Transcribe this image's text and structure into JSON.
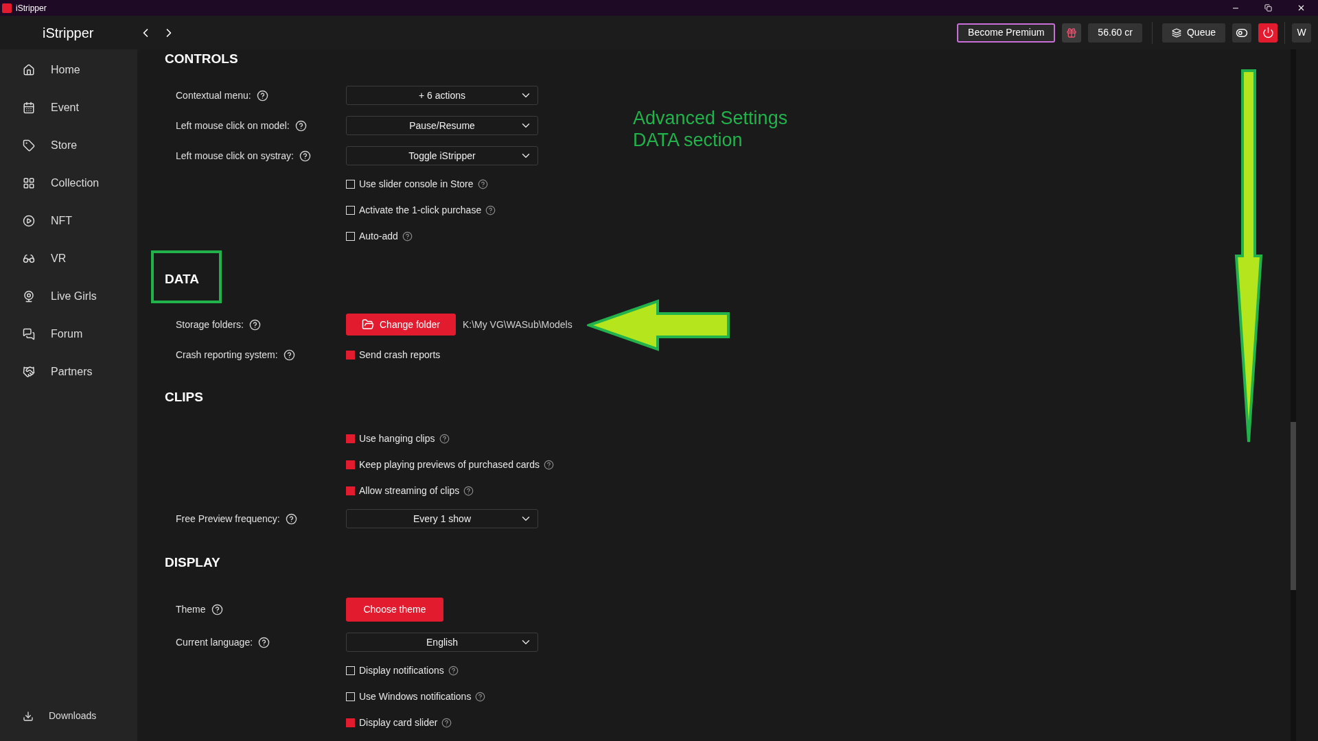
{
  "title_bar": {
    "title": "iStripper"
  },
  "header": {
    "logo": "iStripper",
    "premium_button": "Become Premium",
    "credits": "56.60 cr",
    "queue_button": "Queue",
    "user_button": "W"
  },
  "sidebar": {
    "items": [
      "Home",
      "Event",
      "Store",
      "Collection",
      "NFT",
      "VR",
      "Live Girls",
      "Forum",
      "Partners"
    ],
    "downloads": "Downloads"
  },
  "sections": [
    {
      "title": "CONTROLS",
      "rows": [
        {
          "kind": "dropdown",
          "label": "Contextual menu:",
          "value": "+ 6 actions"
        },
        {
          "kind": "dropdown",
          "label": "Left mouse click on model:",
          "value": "Pause/Resume"
        },
        {
          "kind": "dropdown",
          "label": "Left mouse click on systray:",
          "value": "Toggle iStripper"
        },
        {
          "kind": "checkbox",
          "text": "Use slider console in Store",
          "checked": false,
          "help": true
        },
        {
          "kind": "checkbox",
          "text": "Activate the 1-click purchase",
          "checked": false,
          "help": true
        },
        {
          "kind": "checkbox",
          "text": "Auto-add",
          "checked": false,
          "help": true
        }
      ]
    },
    {
      "title": "DATA",
      "rows": [
        {
          "kind": "folder",
          "label": "Storage folders:",
          "button": "Change folder",
          "path": "K:\\My VG\\WASub\\Models"
        },
        {
          "kind": "checkbox",
          "label": "Crash reporting system:",
          "text": "Send crash reports",
          "checked": true,
          "help": false
        }
      ]
    },
    {
      "title": "CLIPS",
      "rows": [
        {
          "kind": "checkbox",
          "text": "Use hanging clips",
          "checked": true,
          "help": true
        },
        {
          "kind": "checkbox",
          "text": "Keep playing previews of purchased cards",
          "checked": true,
          "help": true
        },
        {
          "kind": "checkbox",
          "text": "Allow streaming of clips",
          "checked": true,
          "help": true
        },
        {
          "kind": "dropdown",
          "label": "Free Preview frequency:",
          "value": "Every 1 show"
        }
      ]
    },
    {
      "title": "DISPLAY",
      "rows": [
        {
          "kind": "button",
          "label": "Theme",
          "button": "Choose theme"
        },
        {
          "kind": "dropdown",
          "label": "Current language:",
          "value": "English"
        },
        {
          "kind": "checkbox",
          "text": "Display notifications",
          "checked": false,
          "help": true
        },
        {
          "kind": "checkbox",
          "text": "Use Windows notifications",
          "checked": false,
          "help": true
        },
        {
          "kind": "checkbox",
          "text": "Display card slider",
          "checked": true,
          "help": true
        }
      ]
    }
  ],
  "annotation": {
    "note_lines": [
      "Advanced Settings",
      "DATA section"
    ]
  }
}
